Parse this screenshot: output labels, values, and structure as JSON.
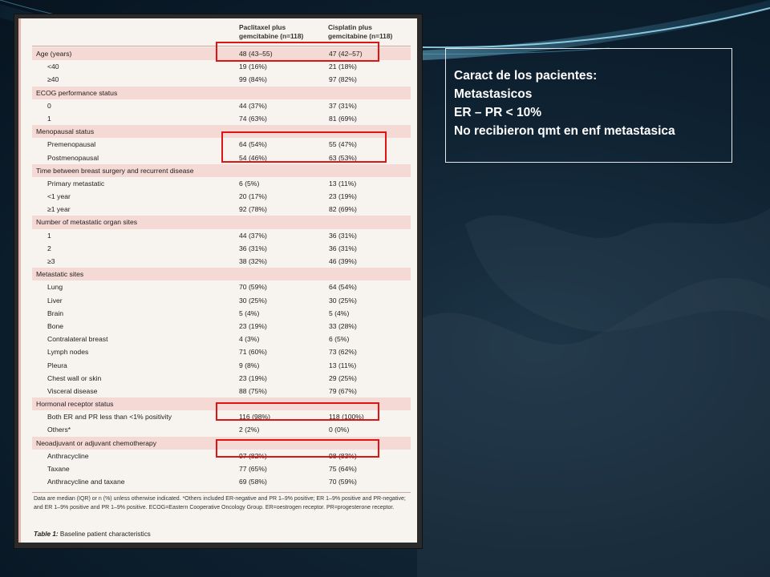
{
  "document": {
    "column_headers": [
      "Paclitaxel plus gemcitabine (n=118)",
      "Cisplatin plus gemcitabine (n=118)"
    ],
    "col1_line1": "Paclitaxel plus",
    "col1_line2": "gemcitabine (n=118)",
    "col2_line1": "Cisplatin plus",
    "col2_line2": "gemcitabine (n=118)",
    "rows": [
      {
        "label": "Age (years)",
        "v1": "48 (43–55)",
        "v2": "47 (42–57)",
        "kind": "section"
      },
      {
        "label": "<40",
        "v1": "19 (16%)",
        "v2": "21 (18%)",
        "kind": "sub"
      },
      {
        "label": "≥40",
        "v1": "99 (84%)",
        "v2": "97 (82%)",
        "kind": "sub"
      },
      {
        "label": "ECOG performance status",
        "v1": "",
        "v2": "",
        "kind": "section"
      },
      {
        "label": "0",
        "v1": "44 (37%)",
        "v2": "37 (31%)",
        "kind": "sub"
      },
      {
        "label": "1",
        "v1": "74 (63%)",
        "v2": "81 (69%)",
        "kind": "sub"
      },
      {
        "label": "Menopausal status",
        "v1": "",
        "v2": "",
        "kind": "section"
      },
      {
        "label": "Premenopausal",
        "v1": "64 (54%)",
        "v2": "55 (47%)",
        "kind": "sub"
      },
      {
        "label": "Postmenopausal",
        "v1": "54 (46%)",
        "v2": "63 (53%)",
        "kind": "sub"
      },
      {
        "label": "Time between breast surgery and recurrent disease",
        "v1": "",
        "v2": "",
        "kind": "section"
      },
      {
        "label": "Primary metastatic",
        "v1": "6 (5%)",
        "v2": "13 (11%)",
        "kind": "sub"
      },
      {
        "label": "<1 year",
        "v1": "20 (17%)",
        "v2": "23 (19%)",
        "kind": "sub"
      },
      {
        "label": "≥1 year",
        "v1": "92 (78%)",
        "v2": "82 (69%)",
        "kind": "sub"
      },
      {
        "label": "Number of metastatic organ sites",
        "v1": "",
        "v2": "",
        "kind": "section"
      },
      {
        "label": "1",
        "v1": "44 (37%)",
        "v2": "36 (31%)",
        "kind": "sub"
      },
      {
        "label": "2",
        "v1": "36 (31%)",
        "v2": "36 (31%)",
        "kind": "sub"
      },
      {
        "label": "≥3",
        "v1": "38 (32%)",
        "v2": "46 (39%)",
        "kind": "sub"
      },
      {
        "label": "Metastatic sites",
        "v1": "",
        "v2": "",
        "kind": "section"
      },
      {
        "label": "Lung",
        "v1": "70 (59%)",
        "v2": "64 (54%)",
        "kind": "sub"
      },
      {
        "label": "Liver",
        "v1": "30 (25%)",
        "v2": "30 (25%)",
        "kind": "sub"
      },
      {
        "label": "Brain",
        "v1": "5 (4%)",
        "v2": "5 (4%)",
        "kind": "sub"
      },
      {
        "label": "Bone",
        "v1": "23 (19%)",
        "v2": "33 (28%)",
        "kind": "sub"
      },
      {
        "label": "Contralateral breast",
        "v1": "4 (3%)",
        "v2": "6 (5%)",
        "kind": "sub"
      },
      {
        "label": "Lymph nodes",
        "v1": "71 (60%)",
        "v2": "73 (62%)",
        "kind": "sub"
      },
      {
        "label": "Pleura",
        "v1": "9 (8%)",
        "v2": "13 (11%)",
        "kind": "sub"
      },
      {
        "label": "Chest wall or skin",
        "v1": "23 (19%)",
        "v2": "29 (25%)",
        "kind": "sub"
      },
      {
        "label": "Visceral disease",
        "v1": "88 (75%)",
        "v2": "79 (67%)",
        "kind": "sub"
      },
      {
        "label": "Hormonal receptor status",
        "v1": "",
        "v2": "",
        "kind": "section"
      },
      {
        "label": "Both ER and PR less than <1% positivity",
        "v1": "116 (98%)",
        "v2": "118 (100%)",
        "kind": "sub"
      },
      {
        "label": "Others*",
        "v1": "2 (2%)",
        "v2": "0 (0%)",
        "kind": "sub"
      },
      {
        "label": "Neoadjuvant or adjuvant chemotherapy",
        "v1": "",
        "v2": "",
        "kind": "section"
      },
      {
        "label": "Anthracycline",
        "v1": "97 (82%)",
        "v2": "98 (83%)",
        "kind": "sub"
      },
      {
        "label": "Taxane",
        "v1": "77 (65%)",
        "v2": "75 (64%)",
        "kind": "sub"
      },
      {
        "label": "Anthracycline and taxane",
        "v1": "69 (58%)",
        "v2": "70 (59%)",
        "kind": "sub"
      }
    ],
    "footnote": "Data are median (IQR) or n (%) unless otherwise indicated. *Others included ER-negative and PR 1–9% positive; ER 1–9% positive and PR-negative; and ER 1–9% positive and PR 1–9% positive. ECOG=Eastern Cooperative Oncology Group. ER=oestrogen receptor. PR=progesterone receptor.",
    "caption_label": "Table 1:",
    "caption_text": " Baseline patient characteristics"
  },
  "note": {
    "lines": [
      "Caract de los pacientes:",
      "Metastasicos",
      "ER – PR < 10%",
      "No recibieron qmt en enf metastasica"
    ]
  },
  "colors": {
    "highlight": "#e01414",
    "section_band": "#f4d9d4",
    "background": "#0f2333",
    "accent_curve": "#5fb4d8"
  }
}
